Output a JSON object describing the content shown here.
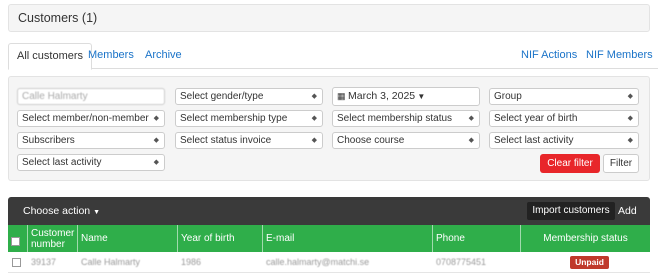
{
  "page": {
    "title": "Customers (1)"
  },
  "tabs": [
    {
      "label": "All customers",
      "active": true
    },
    {
      "label": "Members"
    },
    {
      "label": "Archive"
    },
    {
      "label": "NIF Actions"
    },
    {
      "label": "NIF Members"
    }
  ],
  "filters": {
    "name_value": "Calle Halmarty",
    "gender": "Select gender/type",
    "date": "March 3, 2025",
    "group": "Group",
    "member": "Select member/non-member",
    "membership_type": "Select membership type",
    "membership_status": "Select membership status",
    "year_of_birth": "Select year of birth",
    "subscribers": "Subscribers",
    "status_invoice": "Select status invoice",
    "course": "Choose course",
    "last_activity_1": "Select last activity",
    "last_activity_2": "Select last activity",
    "clear_label": "Clear filter",
    "filter_label": "Filter"
  },
  "actions": {
    "choose_action": "Choose action",
    "import": "Import customers",
    "add": "Add"
  },
  "table": {
    "columns": [
      "Customer number",
      "Name",
      "Year of birth",
      "E-mail",
      "Phone",
      "Membership status"
    ],
    "rows": [
      {
        "number": "39137",
        "name": "Calle Halmarty",
        "year": "1986",
        "email": "calle.halmarty@matchi.se",
        "phone": "0708775451",
        "status": "Unpaid"
      }
    ]
  },
  "colors": {
    "accent_green": "#2fae4a",
    "danger": "#e8262a",
    "link": "#1a73c8",
    "dark_bar": "#3a3a3a"
  }
}
